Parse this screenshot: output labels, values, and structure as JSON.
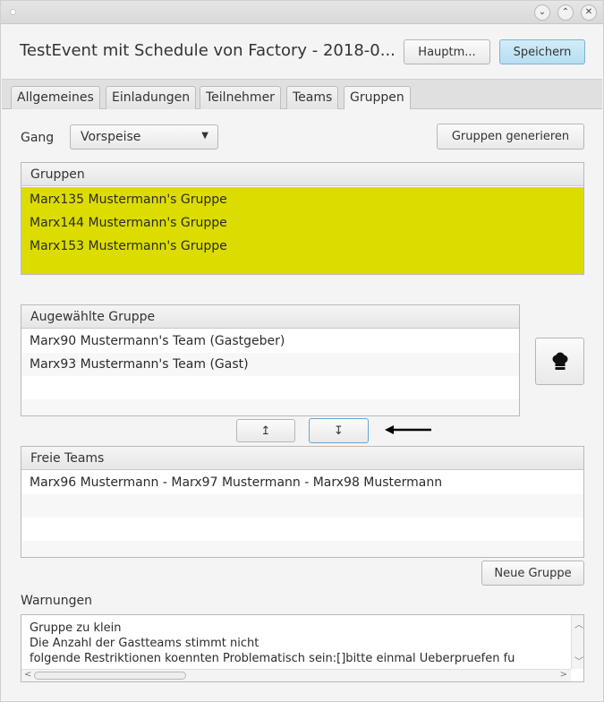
{
  "window": {
    "title": "TestEvent mit Schedule von Factory - 2018-0...",
    "controls": {
      "minimize": "⌄",
      "maximize": "⌃",
      "close": "✕"
    }
  },
  "header": {
    "hauptmenu_label": "Hauptm...",
    "save_label": "Speichern"
  },
  "tabs": [
    {
      "label": "Allgemeines"
    },
    {
      "label": "Einladungen"
    },
    {
      "label": "Teilnehmer"
    },
    {
      "label": "Teams"
    },
    {
      "label": "Gruppen",
      "active": true
    }
  ],
  "gang": {
    "label": "Gang",
    "selected": "Vorspeise"
  },
  "generate_button": "Gruppen generieren",
  "gruppen": {
    "header": "Gruppen",
    "items": [
      "Marx135 Mustermann's Gruppe",
      "Marx144 Mustermann's Gruppe",
      "Marx153 Mustermann's Gruppe"
    ],
    "highlight_color": "#dcdc00"
  },
  "selected_group": {
    "header": "Augewählte Gruppe",
    "items": [
      "Marx90 Mustermann's Team (Gastgeber)",
      "Marx93 Mustermann's Team (Gast)"
    ]
  },
  "chef_icon": "chef-hat-icon",
  "move_buttons": {
    "up": "↥",
    "down": "↧"
  },
  "free_teams": {
    "header": "Freie Teams",
    "items": [
      "Marx96 Mustermann - Marx97 Mustermann - Marx98 Mustermann"
    ]
  },
  "new_group_button": "Neue Gruppe",
  "warnings": {
    "label": "Warnungen",
    "lines": [
      "Gruppe zu klein",
      "Die Anzahl der Gastteams stimmt nicht",
      "folgende Restriktionen koennten Problematisch sein:[]bitte einmal Ueberpruefen fu"
    ]
  },
  "colors": {
    "accent": "#b6def1",
    "highlight": "#dcdc00"
  }
}
